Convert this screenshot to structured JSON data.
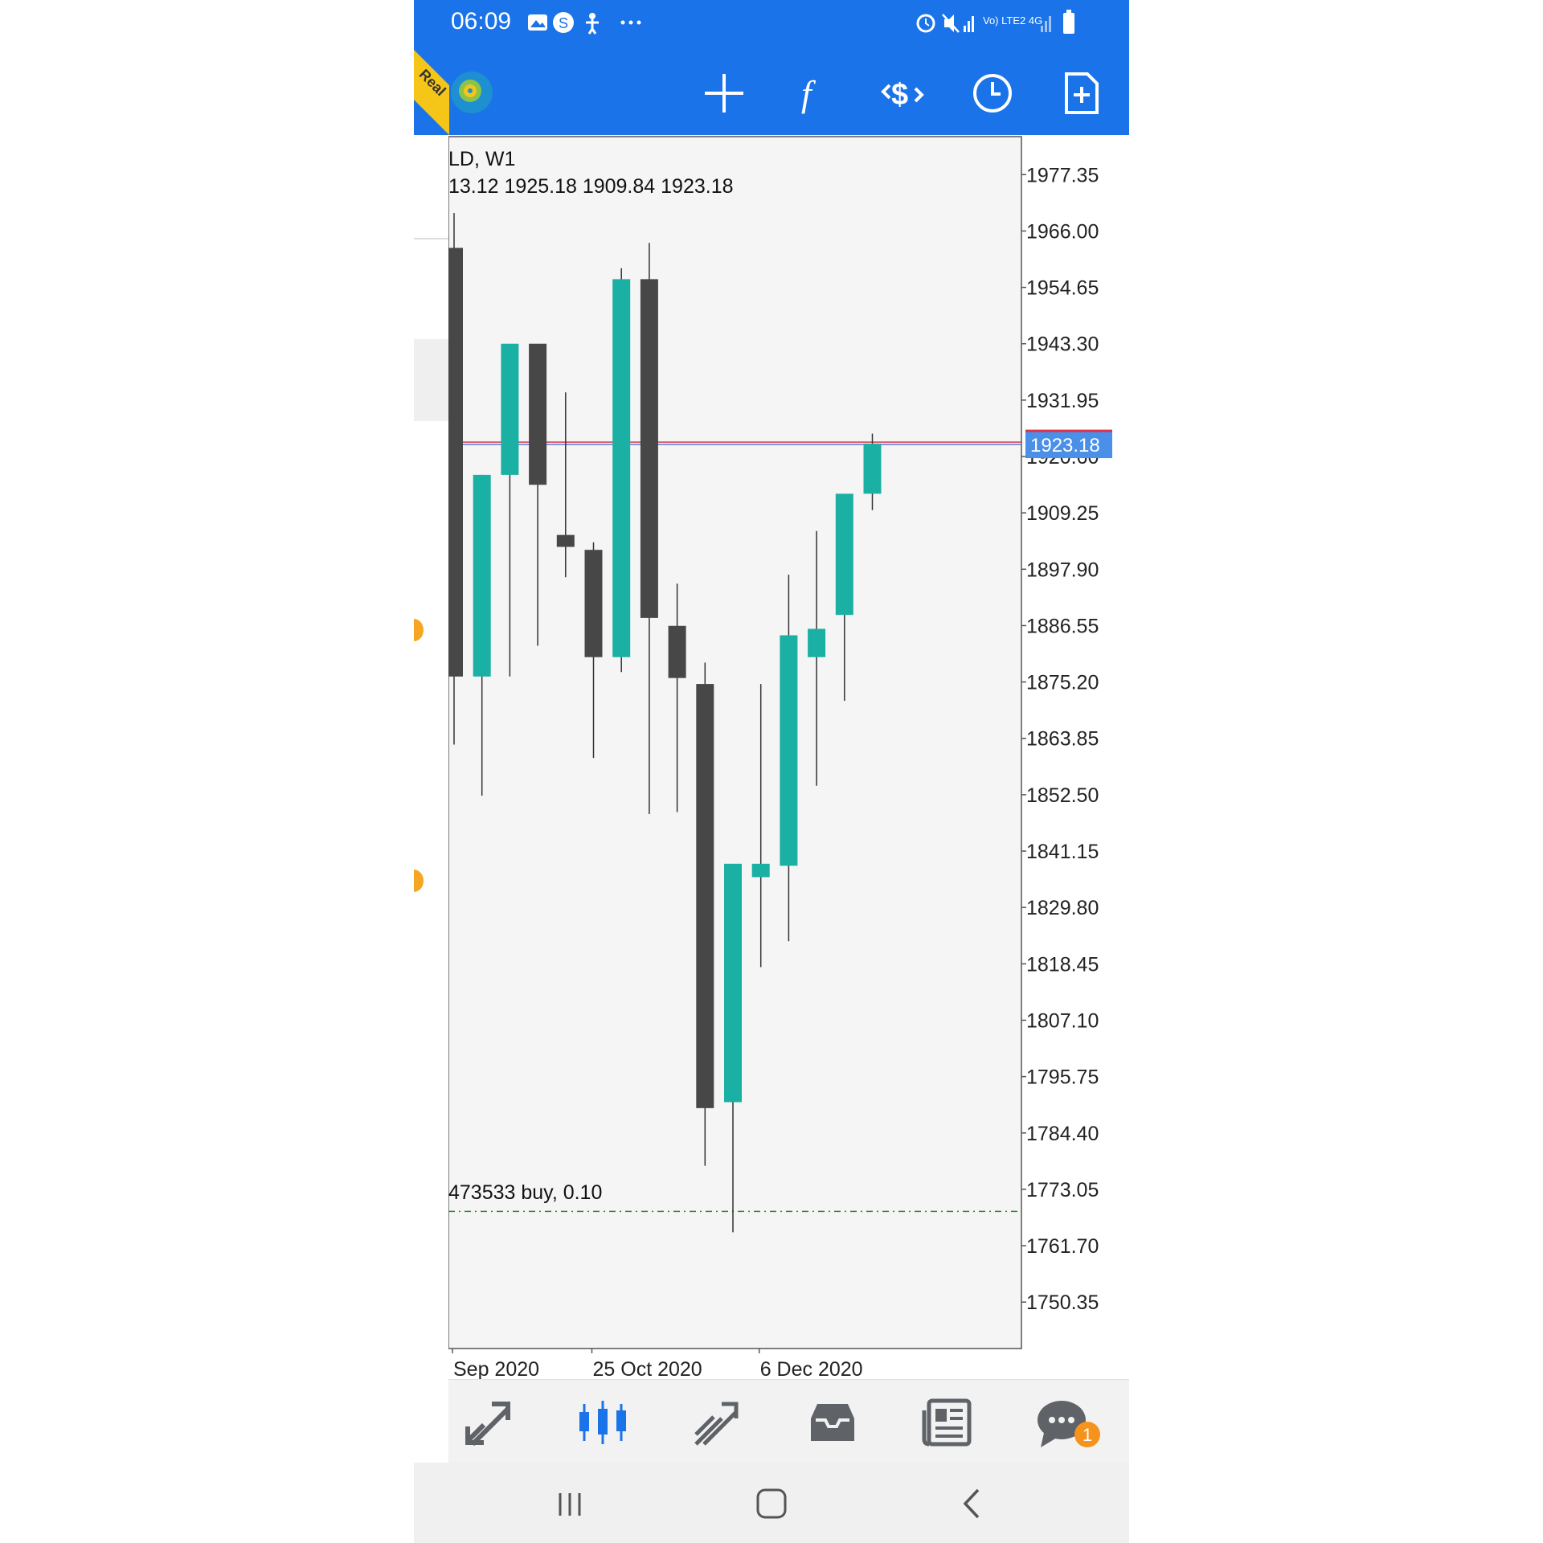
{
  "status_bar": {
    "time": "06:09",
    "left_icons": [
      "image-icon",
      "s-icon",
      "accessibility-icon",
      "more-dots-icon"
    ],
    "right_icons_text": "Vo) LTE2 4G"
  },
  "toolbar": {
    "badge_text": "Real",
    "buttons": [
      {
        "name": "crosshair-icon"
      },
      {
        "name": "indicators-icon",
        "glyph": "f"
      },
      {
        "name": "trade-icon"
      },
      {
        "name": "timeframe-clock-icon"
      },
      {
        "name": "new-order-icon"
      }
    ]
  },
  "chart": {
    "symbol_label": "LD, W1",
    "ohlc_label": "13.12 1925.18 1909.84 1923.18",
    "position_label": "473533 buy, 0.10",
    "current_price_label": "1923.18",
    "bull_color": "#1ab0a4",
    "bear_color": "#474747",
    "price_line_color": "#d9334a",
    "bid_line_color": "#5a7bd8",
    "order_line_color": "#2e8b2e"
  },
  "chart_data": {
    "type": "candlestick",
    "title": "",
    "xlabel": "",
    "ylabel": "",
    "y_ticks": [
      "1977.35",
      "1966.00",
      "1954.65",
      "1943.30",
      "1931.95",
      "1920.60",
      "1909.25",
      "1897.90",
      "1886.55",
      "1875.20",
      "1863.85",
      "1852.50",
      "1841.15",
      "1829.80",
      "1818.45",
      "1807.10",
      "1795.75",
      "1784.40",
      "1773.05",
      "1761.70",
      "1750.35"
    ],
    "ylim": [
      1741.0,
      1985.0
    ],
    "x_labels": [
      {
        "text": "Sep 2020",
        "index": 0
      },
      {
        "text": "25 Oct 2020",
        "index": 5
      },
      {
        "text": "6 Dec 2020",
        "index": 11
      }
    ],
    "candles": [
      {
        "open": 1962.6,
        "high": 1969.6,
        "low": 1862.6,
        "close": 1876.3
      },
      {
        "open": 1876.3,
        "high": 1916.9,
        "low": 1852.3,
        "close": 1916.9
      },
      {
        "open": 1916.9,
        "high": 1936.7,
        "low": 1876.3,
        "close": 1943.3
      },
      {
        "open": 1943.3,
        "high": 1934.7,
        "low": 1882.5,
        "close": 1914.9
      },
      {
        "open": 1904.8,
        "high": 1933.5,
        "low": 1896.3,
        "close": 1902.4
      },
      {
        "open": 1901.8,
        "high": 1903.3,
        "low": 1859.9,
        "close": 1880.2
      },
      {
        "open": 1880.2,
        "high": 1958.5,
        "low": 1877.2,
        "close": 1956.3
      },
      {
        "open": 1956.3,
        "high": 1963.6,
        "low": 1848.6,
        "close": 1888.1
      },
      {
        "open": 1886.5,
        "high": 1895.0,
        "low": 1849.0,
        "close": 1876.0
      },
      {
        "open": 1874.8,
        "high": 1879.1,
        "low": 1777.8,
        "close": 1789.4
      },
      {
        "open": 1790.6,
        "high": 1832.8,
        "low": 1764.4,
        "close": 1838.6
      },
      {
        "open": 1835.9,
        "high": 1874.8,
        "low": 1817.8,
        "close": 1838.6
      },
      {
        "open": 1838.2,
        "high": 1896.8,
        "low": 1823.0,
        "close": 1884.6
      },
      {
        "open": 1880.2,
        "high": 1905.6,
        "low": 1854.3,
        "close": 1885.9
      },
      {
        "open": 1888.7,
        "high": 1911.8,
        "low": 1871.4,
        "close": 1913.1
      },
      {
        "open": 1913.1,
        "high": 1925.2,
        "low": 1909.8,
        "close": 1923.2
      }
    ],
    "current_price": 1923.18,
    "order_price": 1768.6
  },
  "bottom_nav": {
    "items": [
      {
        "name": "quotes-icon"
      },
      {
        "name": "chart-icon",
        "active": true
      },
      {
        "name": "trade-icon"
      },
      {
        "name": "history-icon"
      },
      {
        "name": "news-icon"
      },
      {
        "name": "messages-icon",
        "badge": "1"
      }
    ],
    "active_color": "#1a73e8",
    "icon_color": "#5f6368"
  },
  "system_nav": [
    "recents-icon",
    "home-icon",
    "back-icon"
  ]
}
